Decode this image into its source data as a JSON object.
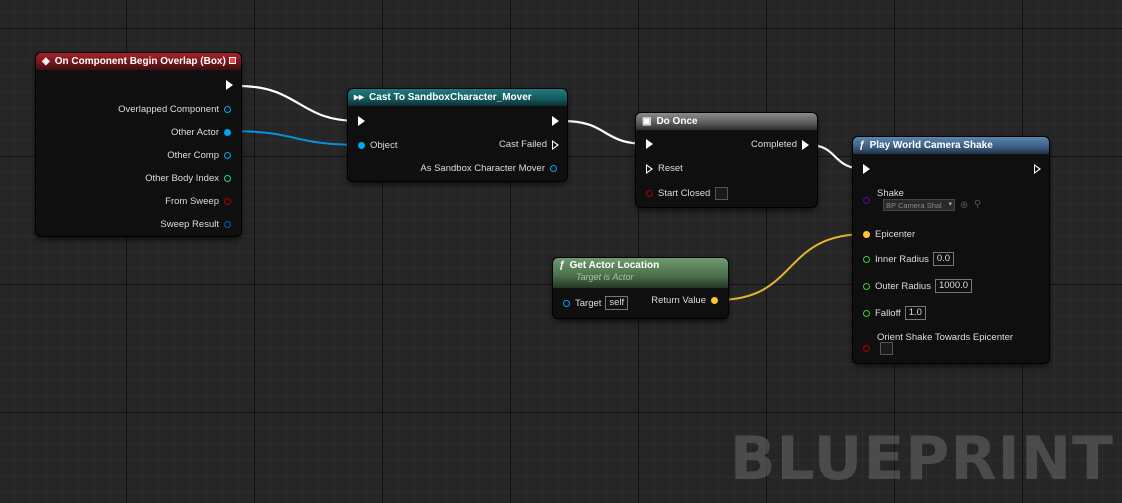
{
  "nodes": {
    "overlap_event": {
      "title": "On Component Begin Overlap (Box)",
      "pins": {
        "overlapped_component": "Overlapped Component",
        "other_actor": "Other Actor",
        "other_comp": "Other Comp",
        "other_body_index": "Other Body Index",
        "from_sweep": "From Sweep",
        "sweep_result": "Sweep Result"
      }
    },
    "cast_node": {
      "title": "Cast To SandboxCharacter_Mover",
      "pins": {
        "object": "Object",
        "cast_failed": "Cast Failed",
        "as_character": "As Sandbox Character Mover"
      }
    },
    "do_once": {
      "title": "Do Once",
      "pins": {
        "completed": "Completed",
        "reset": "Reset",
        "start_closed": "Start Closed"
      }
    },
    "get_actor_location": {
      "title": "Get Actor Location",
      "subtitle": "Target is Actor",
      "pins": {
        "target": "Target",
        "target_value": "self",
        "return_value": "Return Value"
      }
    },
    "camera_shake": {
      "title": "Play World Camera Shake",
      "pins": {
        "shake": "Shake",
        "shake_asset": "BP Camera Shal",
        "epicenter": "Epicenter",
        "inner_radius": "Inner Radius",
        "inner_radius_value": "0.0",
        "outer_radius": "Outer Radius",
        "outer_radius_value": "1000.0",
        "falloff": "Falloff",
        "falloff_value": "1.0",
        "orient": "Orient Shake Towards Epicenter"
      }
    }
  },
  "watermark": "BLUEPRINT",
  "colors": {
    "exec_wire": "#ffffff",
    "object_pin": "#00a6f0",
    "struct_pin": "#0059c9",
    "int_pin": "#1ed6a0",
    "bool_pin": "#920101",
    "class_pin": "#5a00b5",
    "vector_pin": "#fdc82d",
    "float_pin": "#3ad038"
  },
  "icons": {
    "event": "event-diamond-icon",
    "cast": "cast-arrows-icon",
    "do_once": "macro-icon",
    "function": "function-f-icon"
  }
}
